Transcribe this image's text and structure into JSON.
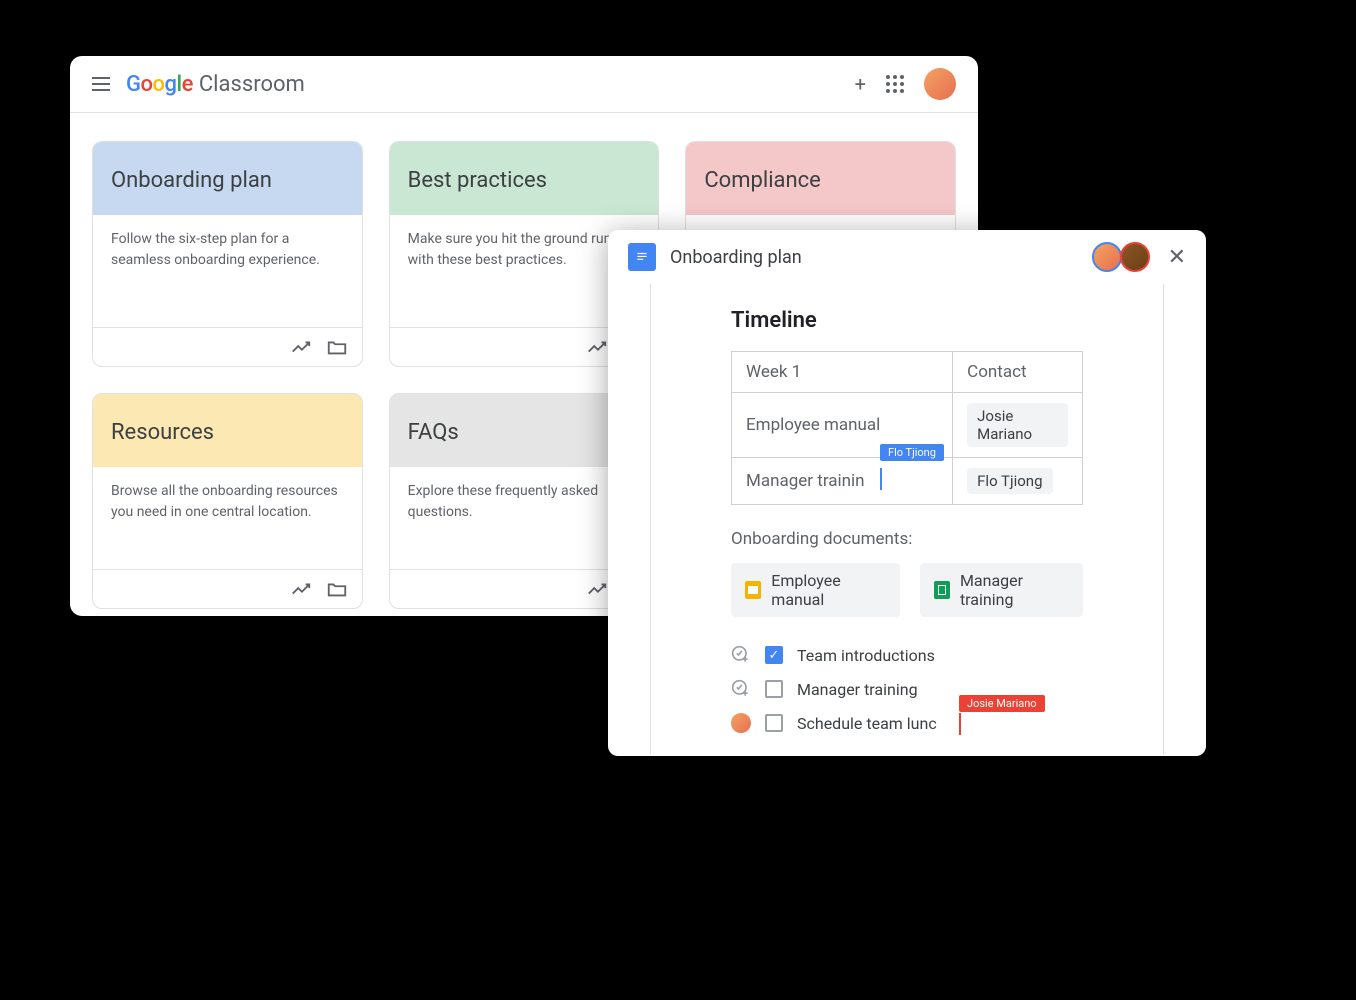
{
  "header": {
    "brand_word_1": "Google",
    "brand_word_2": "Classroom"
  },
  "cards": [
    {
      "title": "Onboarding plan",
      "description": "Follow the six-step plan for a seamless onboarding experience.",
      "color": "blue"
    },
    {
      "title": "Best practices",
      "description": "Make sure you hit the ground running with these best practices.",
      "color": "green"
    },
    {
      "title": "Compliance",
      "description": "",
      "color": "red"
    },
    {
      "title": "Resources",
      "description": "Browse all the onboarding resources you need in one central location.",
      "color": "yellow"
    },
    {
      "title": "FAQs",
      "description": "Explore these frequently asked questions.",
      "color": "gray"
    }
  ],
  "docs": {
    "title": "Onboarding plan",
    "heading": "Timeline",
    "table": {
      "col1_header": "Week 1",
      "col2_header": "Contact",
      "rows": [
        {
          "item": "Employee manual",
          "contact": "Josie Mariano"
        },
        {
          "item": "Manager trainin",
          "contact": "Flo Tjiong"
        }
      ]
    },
    "collaborators": [
      {
        "name": "Flo Tjiong",
        "color": "blue"
      },
      {
        "name": "Josie Mariano",
        "color": "red"
      }
    ],
    "section_label": "Onboarding documents:",
    "links": [
      {
        "label": "Employee manual",
        "app": "slides"
      },
      {
        "label": "Manager training",
        "app": "sheets"
      }
    ],
    "checklist": [
      {
        "label": "Team introductions",
        "checked": true,
        "author": "add"
      },
      {
        "label": "Manager training",
        "checked": false,
        "author": "add"
      },
      {
        "label": "Schedule team lunc",
        "checked": false,
        "author": "avatar"
      }
    ]
  }
}
